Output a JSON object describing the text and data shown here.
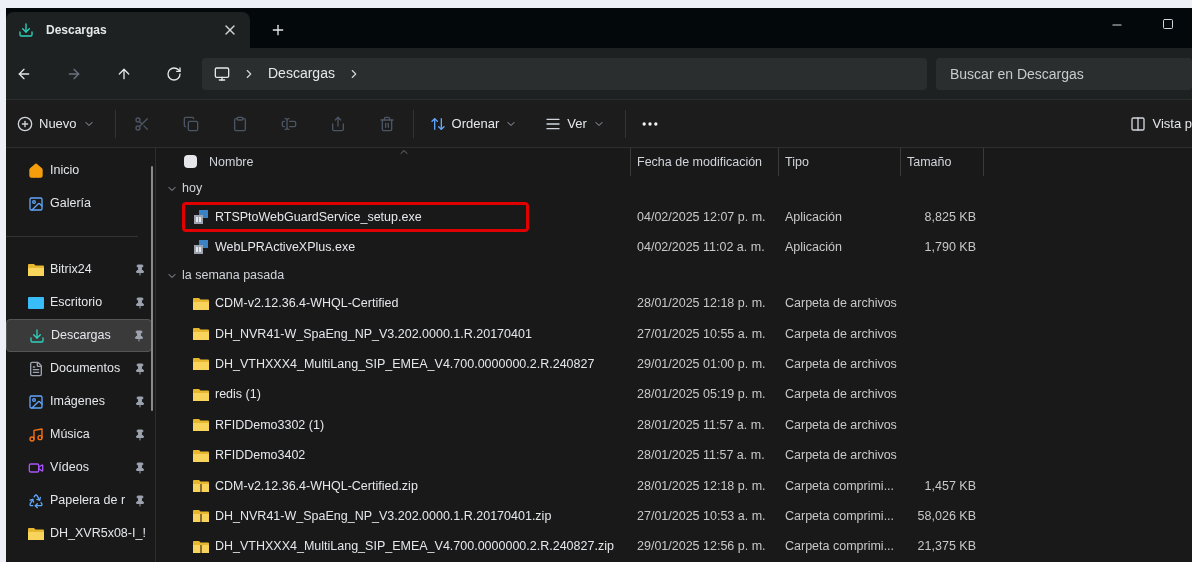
{
  "tab": {
    "title": "Descargas",
    "selected": true
  },
  "nav": {
    "address": [
      "Descargas"
    ],
    "search": {
      "placeholder": "Buscar en Descargas"
    }
  },
  "toolbar": {
    "new_label": "Nuevo",
    "actions": [
      {
        "kind": "cut",
        "disabled": true
      },
      {
        "kind": "copy",
        "disabled": true
      },
      {
        "kind": "paste",
        "disabled": true
      },
      {
        "kind": "rename",
        "disabled": true
      },
      {
        "kind": "share",
        "disabled": true
      },
      {
        "kind": "delete",
        "disabled": true
      }
    ],
    "sort_label": "Ordenar",
    "view_label": "Ver",
    "preview_label": "Vista p"
  },
  "sidebar": {
    "groups": [
      [
        {
          "label": "Inicio",
          "kind": "home",
          "pinned": false,
          "selected": false
        },
        {
          "label": "Galería",
          "kind": "gallery",
          "pinned": false,
          "selected": false
        }
      ],
      [
        {
          "label": "Bitrix24",
          "kind": "folder",
          "pinned": true,
          "selected": false
        },
        {
          "label": "Escritorio",
          "kind": "desktop",
          "pinned": true,
          "selected": false
        },
        {
          "label": "Descargas",
          "kind": "downloads",
          "pinned": true,
          "selected": true
        },
        {
          "label": "Documentos",
          "kind": "documents",
          "pinned": true,
          "selected": false
        },
        {
          "label": "Imágenes",
          "kind": "pictures",
          "pinned": true,
          "selected": false
        },
        {
          "label": "Música",
          "kind": "music",
          "pinned": true,
          "selected": false
        },
        {
          "label": "Vídeos",
          "kind": "videos",
          "pinned": true,
          "selected": false
        },
        {
          "label": "Papelera de r",
          "kind": "recycle",
          "pinned": true,
          "selected": false
        },
        {
          "label": "DH_XVR5x08-I_!",
          "kind": "folder",
          "pinned": false,
          "selected": false
        }
      ]
    ]
  },
  "table": {
    "select_all": {
      "checked": false
    },
    "columns": [
      "Nombre",
      "Fecha de modificación",
      "Tipo",
      "Tamaño"
    ],
    "groups": [
      {
        "label": "hoy",
        "expanded": true,
        "rows": [
          {
            "kind": "app",
            "name": "RTSPtoWebGuardService_setup.exe",
            "modified": "04/02/2025 12:07 p. m.",
            "type": "Aplicación",
            "size": "8,825 KB",
            "highlighted": true
          },
          {
            "kind": "app",
            "name": "WebLPRActiveXPlus.exe",
            "modified": "04/02/2025 11:02 a. m.",
            "type": "Aplicación",
            "size": "1,790 KB",
            "highlighted": false
          }
        ]
      },
      {
        "label": "la semana pasada",
        "expanded": true,
        "rows": [
          {
            "kind": "folder",
            "name": "CDM-v2.12.36.4-WHQL-Certified",
            "modified": "28/01/2025 12:18 p. m.",
            "type": "Carpeta de archivos",
            "highlighted": false
          },
          {
            "kind": "folder",
            "name": "DH_NVR41-W_SpaEng_NP_V3.202.0000.1.R.20170401",
            "modified": "27/01/2025 10:55 a. m.",
            "type": "Carpeta de archivos",
            "highlighted": false
          },
          {
            "kind": "folder",
            "name": "DH_VTHXXX4_MultiLang_SIP_EMEA_V4.700.0000000.2.R.240827",
            "modified": "29/01/2025 01:00 p. m.",
            "type": "Carpeta de archivos",
            "highlighted": false
          },
          {
            "kind": "folder",
            "name": "redis (1)",
            "modified": "28/01/2025 05:19 p. m.",
            "type": "Carpeta de archivos",
            "highlighted": false
          },
          {
            "kind": "folder",
            "name": "RFIDDemo3302 (1)",
            "modified": "28/01/2025 11:57 a. m.",
            "type": "Carpeta de archivos",
            "highlighted": false
          },
          {
            "kind": "folder",
            "name": "RFIDDemo3402",
            "modified": "28/01/2025 11:57 a. m.",
            "type": "Carpeta de archivos",
            "highlighted": false
          },
          {
            "kind": "zip",
            "name": "CDM-v2.12.36.4-WHQL-Certified.zip",
            "modified": "28/01/2025 12:18 p. m.",
            "type": "Carpeta comprimi...",
            "size": "1,457 KB",
            "highlighted": false
          },
          {
            "kind": "zip",
            "name": "DH_NVR41-W_SpaEng_NP_V3.202.0000.1.R.20170401.zip",
            "modified": "27/01/2025 10:53 a. m.",
            "type": "Carpeta comprimi...",
            "size": "58,026 KB",
            "highlighted": false
          },
          {
            "kind": "zip",
            "name": "DH_VTHXXX4_MultiLang_SIP_EMEA_V4.700.0000000.2.R.240827.zip",
            "modified": "29/01/2025 12:56 p. m.",
            "type": "Carpeta comprimi...",
            "size": "21,375 KB",
            "highlighted": false
          }
        ]
      }
    ]
  }
}
